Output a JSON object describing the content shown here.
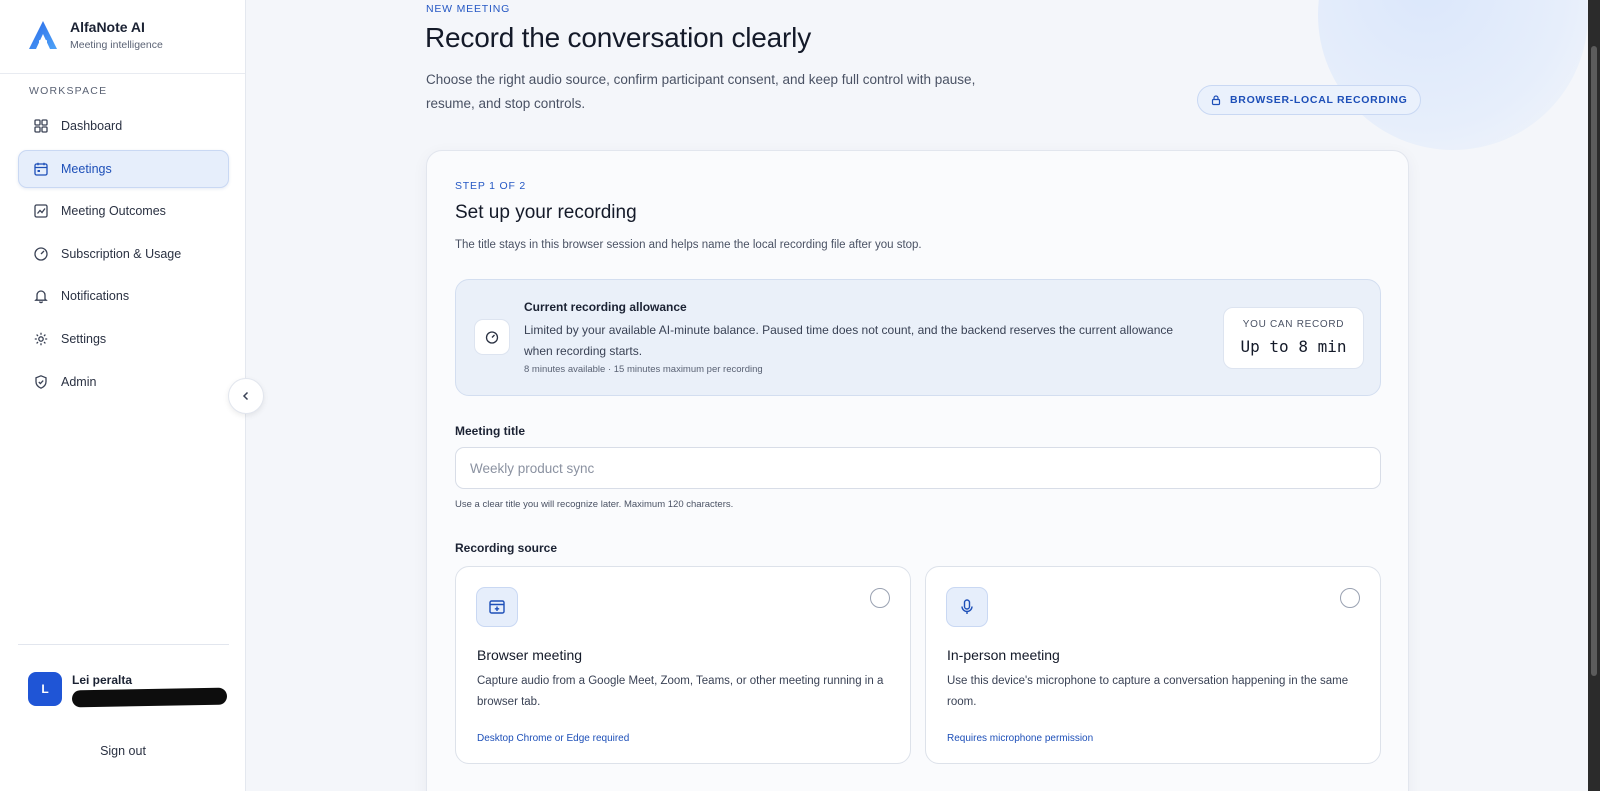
{
  "brand": {
    "name": "AlfaNote AI",
    "subtitle": "Meeting intelligence",
    "accent": "#1f55d6"
  },
  "sidebar": {
    "section_label": "WORKSPACE",
    "items": [
      {
        "label": "Dashboard",
        "icon": "grid-icon",
        "active": false
      },
      {
        "label": "Meetings",
        "icon": "calendar-icon",
        "active": true
      },
      {
        "label": "Meeting Outcomes",
        "icon": "chart-check-icon",
        "active": false
      },
      {
        "label": "Subscription & Usage",
        "icon": "gauge-icon",
        "active": false
      },
      {
        "label": "Notifications",
        "icon": "bell-icon",
        "active": false
      },
      {
        "label": "Settings",
        "icon": "gear-icon",
        "active": false
      },
      {
        "label": "Admin",
        "icon": "shield-icon",
        "active": false
      }
    ],
    "user": {
      "initial": "L",
      "name": "Lei peralta"
    },
    "sign_out": "Sign out"
  },
  "header": {
    "eyebrow": "NEW MEETING",
    "title": "Record the conversation clearly",
    "description": "Choose the right audio source, confirm participant consent, and keep full control with pause, resume, and stop controls.",
    "badge": "BROWSER-LOCAL RECORDING"
  },
  "setup": {
    "step": "STEP 1 OF 2",
    "title": "Set up your recording",
    "description": "The title stays in this browser session and helps name the local recording file after you stop.",
    "allowance": {
      "title": "Current recording allowance",
      "text": "Limited by your available AI-minute balance. Paused time does not count, and the backend reserves the current allowance when recording starts.",
      "meta": "8 minutes available · 15 minutes maximum per recording",
      "box_label": "YOU CAN RECORD",
      "box_value": "Up to 8 min"
    },
    "meeting_title": {
      "label": "Meeting title",
      "placeholder": "Weekly product sync",
      "value": "",
      "hint": "Use a clear title you will recognize later. Maximum 120 characters."
    },
    "source": {
      "label": "Recording source",
      "options": [
        {
          "title": "Browser meeting",
          "description": "Capture audio from a Google Meet, Zoom, Teams, or other meeting running in a browser tab.",
          "note": "Desktop Chrome or Edge required",
          "icon": "browser-tab-icon",
          "selected": false
        },
        {
          "title": "In-person meeting",
          "description": "Use this device's microphone to capture a conversation happening in the same room.",
          "note": "Requires microphone permission",
          "icon": "microphone-icon",
          "selected": false
        }
      ]
    }
  }
}
